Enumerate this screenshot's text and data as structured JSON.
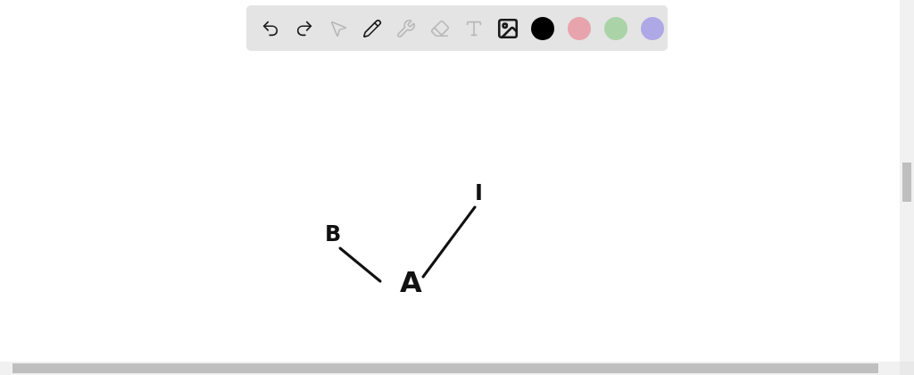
{
  "toolbar": {
    "tools": [
      {
        "kind": "undo",
        "disabled": false
      },
      {
        "kind": "redo",
        "disabled": false
      },
      {
        "kind": "select",
        "disabled": true
      },
      {
        "kind": "pen",
        "disabled": false
      },
      {
        "kind": "tools",
        "disabled": true
      },
      {
        "kind": "eraser",
        "disabled": true
      },
      {
        "kind": "text",
        "disabled": true
      },
      {
        "kind": "image",
        "disabled": false
      }
    ],
    "colors": [
      {
        "color": "#000000"
      },
      {
        "color": "#e8a4ad"
      },
      {
        "color": "#abd3a8"
      },
      {
        "color": "#aea8e6"
      }
    ]
  },
  "canvas": {
    "labels": [
      {
        "text": "B"
      },
      {
        "text": "A"
      },
      {
        "text": "I"
      }
    ]
  }
}
